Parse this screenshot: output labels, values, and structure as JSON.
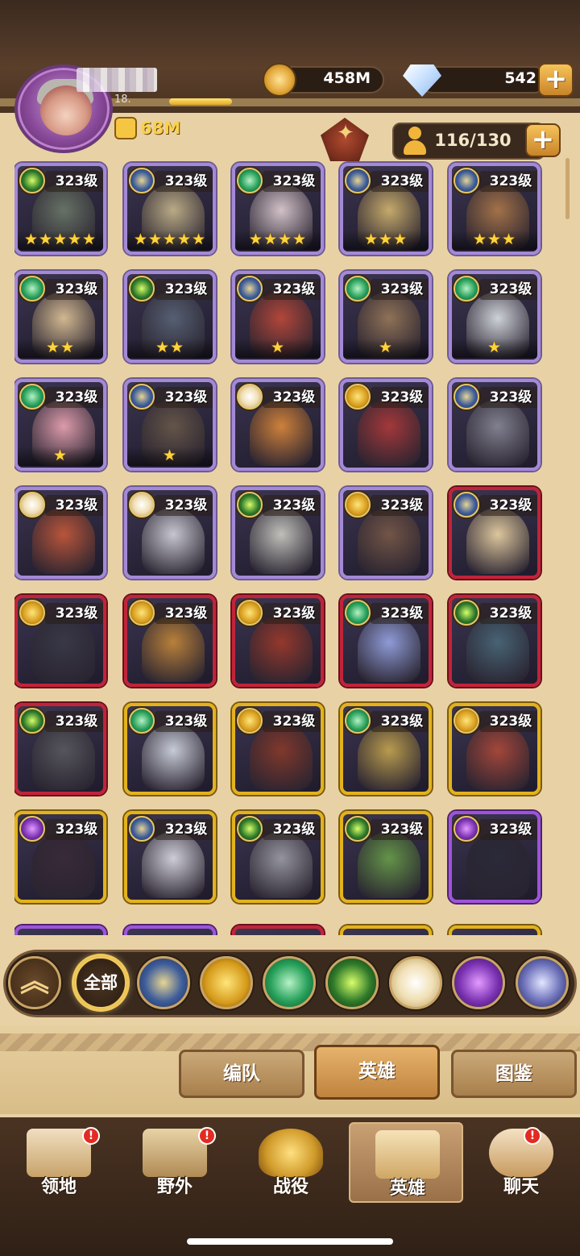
{
  "header": {
    "player_level_partial": "18.",
    "power": "68M",
    "gold": "458M",
    "gems": "542",
    "plus_symbol": "+"
  },
  "hero_count": {
    "value": "116/130",
    "plus_symbol": "+"
  },
  "heroes": [
    {
      "level": "323级",
      "stars": "★★★★★",
      "faction": "eye",
      "tier": "ascended"
    },
    {
      "level": "323级",
      "stars": "★★★★★",
      "faction": "blue",
      "tier": "ascended"
    },
    {
      "level": "323级",
      "stars": "★★★★",
      "faction": "green",
      "tier": "ascended"
    },
    {
      "level": "323级",
      "stars": "★★★",
      "faction": "blue",
      "tier": "ascended"
    },
    {
      "level": "323级",
      "stars": "★★★",
      "faction": "blue",
      "tier": "ascended"
    },
    {
      "level": "323级",
      "stars": "★★",
      "faction": "green",
      "tier": "ascended"
    },
    {
      "level": "323级",
      "stars": "★★",
      "faction": "eye",
      "tier": "ascended"
    },
    {
      "level": "323级",
      "stars": "★",
      "faction": "blue",
      "tier": "ascended"
    },
    {
      "level": "323级",
      "stars": "★",
      "faction": "green",
      "tier": "ascended"
    },
    {
      "level": "323级",
      "stars": "★",
      "faction": "green",
      "tier": "ascended"
    },
    {
      "level": "323级",
      "stars": "★",
      "faction": "green",
      "tier": "ascended"
    },
    {
      "level": "323级",
      "stars": "★",
      "faction": "blue",
      "tier": "ascended"
    },
    {
      "level": "323级",
      "stars": "",
      "faction": "light",
      "tier": "ascended"
    },
    {
      "level": "323级",
      "stars": "",
      "faction": "gold",
      "tier": "ascended"
    },
    {
      "level": "323级",
      "stars": "",
      "faction": "blue",
      "tier": "ascended"
    },
    {
      "level": "323级",
      "stars": "",
      "faction": "light",
      "tier": "ascended"
    },
    {
      "level": "323级",
      "stars": "",
      "faction": "light",
      "tier": "ascended"
    },
    {
      "level": "323级",
      "stars": "",
      "faction": "eye",
      "tier": "ascended"
    },
    {
      "level": "323级",
      "stars": "",
      "faction": "gold",
      "tier": "ascended"
    },
    {
      "level": "323级",
      "stars": "",
      "faction": "blue",
      "tier": "legend"
    },
    {
      "level": "323级",
      "stars": "",
      "faction": "gold",
      "tier": "legend"
    },
    {
      "level": "323级",
      "stars": "",
      "faction": "gold",
      "tier": "legend"
    },
    {
      "level": "323级",
      "stars": "",
      "faction": "gold",
      "tier": "legend"
    },
    {
      "level": "323级",
      "stars": "",
      "faction": "green",
      "tier": "legend"
    },
    {
      "level": "323级",
      "stars": "",
      "faction": "eye",
      "tier": "legend"
    },
    {
      "level": "323级",
      "stars": "",
      "faction": "eye",
      "tier": "legend"
    },
    {
      "level": "323级",
      "stars": "",
      "faction": "green",
      "tier": "mythic"
    },
    {
      "level": "323级",
      "stars": "",
      "faction": "gold",
      "tier": "mythic"
    },
    {
      "level": "323级",
      "stars": "",
      "faction": "green",
      "tier": "mythic"
    },
    {
      "level": "323级",
      "stars": "",
      "faction": "gold",
      "tier": "mythic"
    },
    {
      "level": "323级",
      "stars": "",
      "faction": "dark",
      "tier": "mythic"
    },
    {
      "level": "323级",
      "stars": "",
      "faction": "blue",
      "tier": "mythic"
    },
    {
      "level": "323级",
      "stars": "",
      "faction": "eye",
      "tier": "mythic"
    },
    {
      "level": "323级",
      "stars": "",
      "faction": "eye",
      "tier": "mythic"
    },
    {
      "level": "323级",
      "stars": "",
      "faction": "dark",
      "tier": "purple"
    }
  ],
  "filters": {
    "collapse_icon": "︽",
    "all_label": "全部",
    "factions": [
      "blue",
      "gold",
      "green",
      "eye",
      "light",
      "dark",
      "void"
    ]
  },
  "subtabs": [
    "编队",
    "英雄",
    "图鉴"
  ],
  "nav": [
    {
      "label": "领地",
      "badge": "!"
    },
    {
      "label": "野外",
      "badge": "!"
    },
    {
      "label": "战役",
      "badge": ""
    },
    {
      "label": "英雄",
      "badge": ""
    },
    {
      "label": "聊天",
      "badge": "!"
    }
  ],
  "colors": {
    "accent_gold": "#f8d24d",
    "badge_red": "#e22b22",
    "panel_bg": "#e8d2a5"
  }
}
